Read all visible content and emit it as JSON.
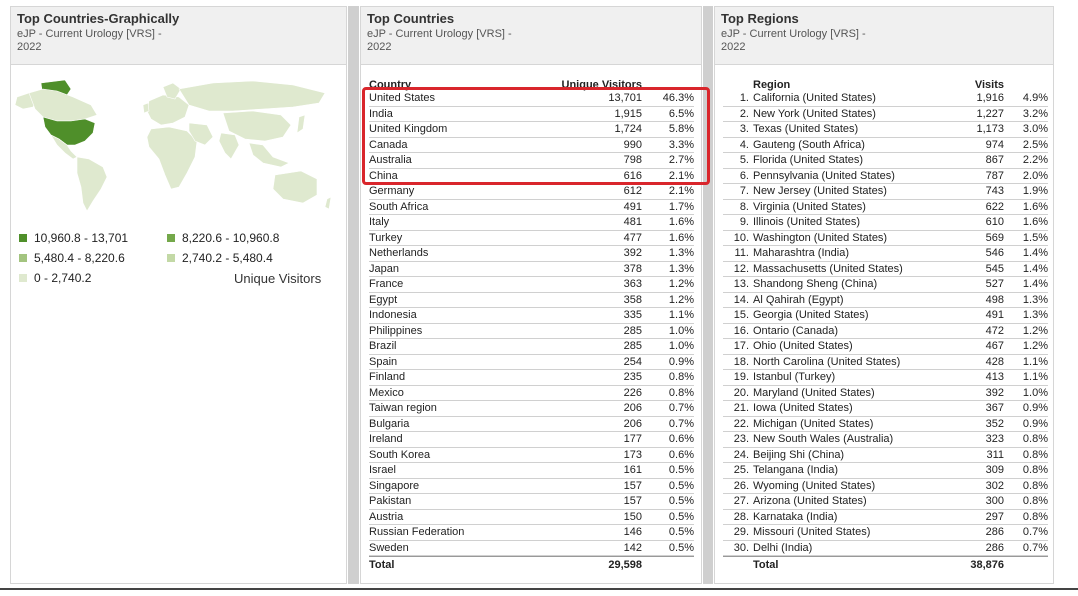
{
  "map_panel": {
    "title": "Top Countries-Graphically",
    "subtitle": "eJP - Current Urology [VRS] -",
    "year": "2022",
    "legend": [
      {
        "label": "10,960.8 - 13,701",
        "color": "#4f8f2a"
      },
      {
        "label": "8,220.6 - 10,960.8",
        "color": "#74a84a"
      },
      {
        "label": "5,480.4 - 8,220.6",
        "color": "#a3c47f"
      },
      {
        "label": "2,740.2 - 5,480.4",
        "color": "#c3d9a6"
      },
      {
        "label": "0 - 2,740.2",
        "color": "#dfe9cf"
      }
    ],
    "legend_title": "Unique Visitors"
  },
  "countries_panel": {
    "title": "Top Countries",
    "subtitle": "eJP - Current Urology [VRS] -",
    "year": "2022",
    "col_country": "Country",
    "col_visitors": "Unique Visitors",
    "rows": [
      {
        "name": "United States",
        "value": "13,701",
        "pct": "46.3%"
      },
      {
        "name": "India",
        "value": "1,915",
        "pct": "6.5%"
      },
      {
        "name": "United Kingdom",
        "value": "1,724",
        "pct": "5.8%"
      },
      {
        "name": "Canada",
        "value": "990",
        "pct": "3.3%"
      },
      {
        "name": "Australia",
        "value": "798",
        "pct": "2.7%"
      },
      {
        "name": "China",
        "value": "616",
        "pct": "2.1%"
      },
      {
        "name": "Germany",
        "value": "612",
        "pct": "2.1%"
      },
      {
        "name": "South Africa",
        "value": "491",
        "pct": "1.7%"
      },
      {
        "name": "Italy",
        "value": "481",
        "pct": "1.6%"
      },
      {
        "name": "Turkey",
        "value": "477",
        "pct": "1.6%"
      },
      {
        "name": "Netherlands",
        "value": "392",
        "pct": "1.3%"
      },
      {
        "name": "Japan",
        "value": "378",
        "pct": "1.3%"
      },
      {
        "name": "France",
        "value": "363",
        "pct": "1.2%"
      },
      {
        "name": "Egypt",
        "value": "358",
        "pct": "1.2%"
      },
      {
        "name": "Indonesia",
        "value": "335",
        "pct": "1.1%"
      },
      {
        "name": "Philippines",
        "value": "285",
        "pct": "1.0%"
      },
      {
        "name": "Brazil",
        "value": "285",
        "pct": "1.0%"
      },
      {
        "name": "Spain",
        "value": "254",
        "pct": "0.9%"
      },
      {
        "name": "Finland",
        "value": "235",
        "pct": "0.8%"
      },
      {
        "name": "Mexico",
        "value": "226",
        "pct": "0.8%"
      },
      {
        "name": "Taiwan region",
        "value": "206",
        "pct": "0.7%"
      },
      {
        "name": "Bulgaria",
        "value": "206",
        "pct": "0.7%"
      },
      {
        "name": "Ireland",
        "value": "177",
        "pct": "0.6%"
      },
      {
        "name": "South Korea",
        "value": "173",
        "pct": "0.6%"
      },
      {
        "name": "Israel",
        "value": "161",
        "pct": "0.5%"
      },
      {
        "name": "Singapore",
        "value": "157",
        "pct": "0.5%"
      },
      {
        "name": "Pakistan",
        "value": "157",
        "pct": "0.5%"
      },
      {
        "name": "Austria",
        "value": "150",
        "pct": "0.5%"
      },
      {
        "name": "Russian Federation",
        "value": "146",
        "pct": "0.5%"
      },
      {
        "name": "Sweden",
        "value": "142",
        "pct": "0.5%"
      }
    ],
    "total_label": "Total",
    "total_value": "29,598"
  },
  "regions_panel": {
    "title": "Top Regions",
    "subtitle": "eJP - Current Urology [VRS] -",
    "year": "2022",
    "col_region": "Region",
    "col_visits": "Visits",
    "rows": [
      {
        "rank": "1.",
        "name": "California (United States)",
        "value": "1,916",
        "pct": "4.9%"
      },
      {
        "rank": "2.",
        "name": "New York (United States)",
        "value": "1,227",
        "pct": "3.2%"
      },
      {
        "rank": "3.",
        "name": "Texas (United States)",
        "value": "1,173",
        "pct": "3.0%"
      },
      {
        "rank": "4.",
        "name": "Gauteng (South Africa)",
        "value": "974",
        "pct": "2.5%"
      },
      {
        "rank": "5.",
        "name": "Florida (United States)",
        "value": "867",
        "pct": "2.2%"
      },
      {
        "rank": "6.",
        "name": "Pennsylvania (United States)",
        "value": "787",
        "pct": "2.0%"
      },
      {
        "rank": "7.",
        "name": "New Jersey (United States)",
        "value": "743",
        "pct": "1.9%"
      },
      {
        "rank": "8.",
        "name": "Virginia (United States)",
        "value": "622",
        "pct": "1.6%"
      },
      {
        "rank": "9.",
        "name": "Illinois (United States)",
        "value": "610",
        "pct": "1.6%"
      },
      {
        "rank": "10.",
        "name": "Washington (United States)",
        "value": "569",
        "pct": "1.5%"
      },
      {
        "rank": "11.",
        "name": "Maharashtra (India)",
        "value": "546",
        "pct": "1.4%"
      },
      {
        "rank": "12.",
        "name": "Massachusetts (United States)",
        "value": "545",
        "pct": "1.4%"
      },
      {
        "rank": "13.",
        "name": "Shandong Sheng (China)",
        "value": "527",
        "pct": "1.4%"
      },
      {
        "rank": "14.",
        "name": "Al Qahirah (Egypt)",
        "value": "498",
        "pct": "1.3%"
      },
      {
        "rank": "15.",
        "name": "Georgia (United States)",
        "value": "491",
        "pct": "1.3%"
      },
      {
        "rank": "16.",
        "name": "Ontario (Canada)",
        "value": "472",
        "pct": "1.2%"
      },
      {
        "rank": "17.",
        "name": "Ohio (United States)",
        "value": "467",
        "pct": "1.2%"
      },
      {
        "rank": "18.",
        "name": "North Carolina (United States)",
        "value": "428",
        "pct": "1.1%"
      },
      {
        "rank": "19.",
        "name": "Istanbul (Turkey)",
        "value": "413",
        "pct": "1.1%"
      },
      {
        "rank": "20.",
        "name": "Maryland (United States)",
        "value": "392",
        "pct": "1.0%"
      },
      {
        "rank": "21.",
        "name": "Iowa (United States)",
        "value": "367",
        "pct": "0.9%"
      },
      {
        "rank": "22.",
        "name": "Michigan (United States)",
        "value": "352",
        "pct": "0.9%"
      },
      {
        "rank": "23.",
        "name": "New South Wales (Australia)",
        "value": "323",
        "pct": "0.8%"
      },
      {
        "rank": "24.",
        "name": "Beijing Shi (China)",
        "value": "311",
        "pct": "0.8%"
      },
      {
        "rank": "25.",
        "name": "Telangana (India)",
        "value": "309",
        "pct": "0.8%"
      },
      {
        "rank": "26.",
        "name": "Wyoming (United States)",
        "value": "302",
        "pct": "0.8%"
      },
      {
        "rank": "27.",
        "name": "Arizona (United States)",
        "value": "300",
        "pct": "0.8%"
      },
      {
        "rank": "28.",
        "name": "Karnataka (India)",
        "value": "297",
        "pct": "0.8%"
      },
      {
        "rank": "29.",
        "name": "Missouri (United States)",
        "value": "286",
        "pct": "0.7%"
      },
      {
        "rank": "30.",
        "name": "Delhi (India)",
        "value": "286",
        "pct": "0.7%"
      }
    ],
    "total_label": "Total",
    "total_value": "38,876"
  }
}
